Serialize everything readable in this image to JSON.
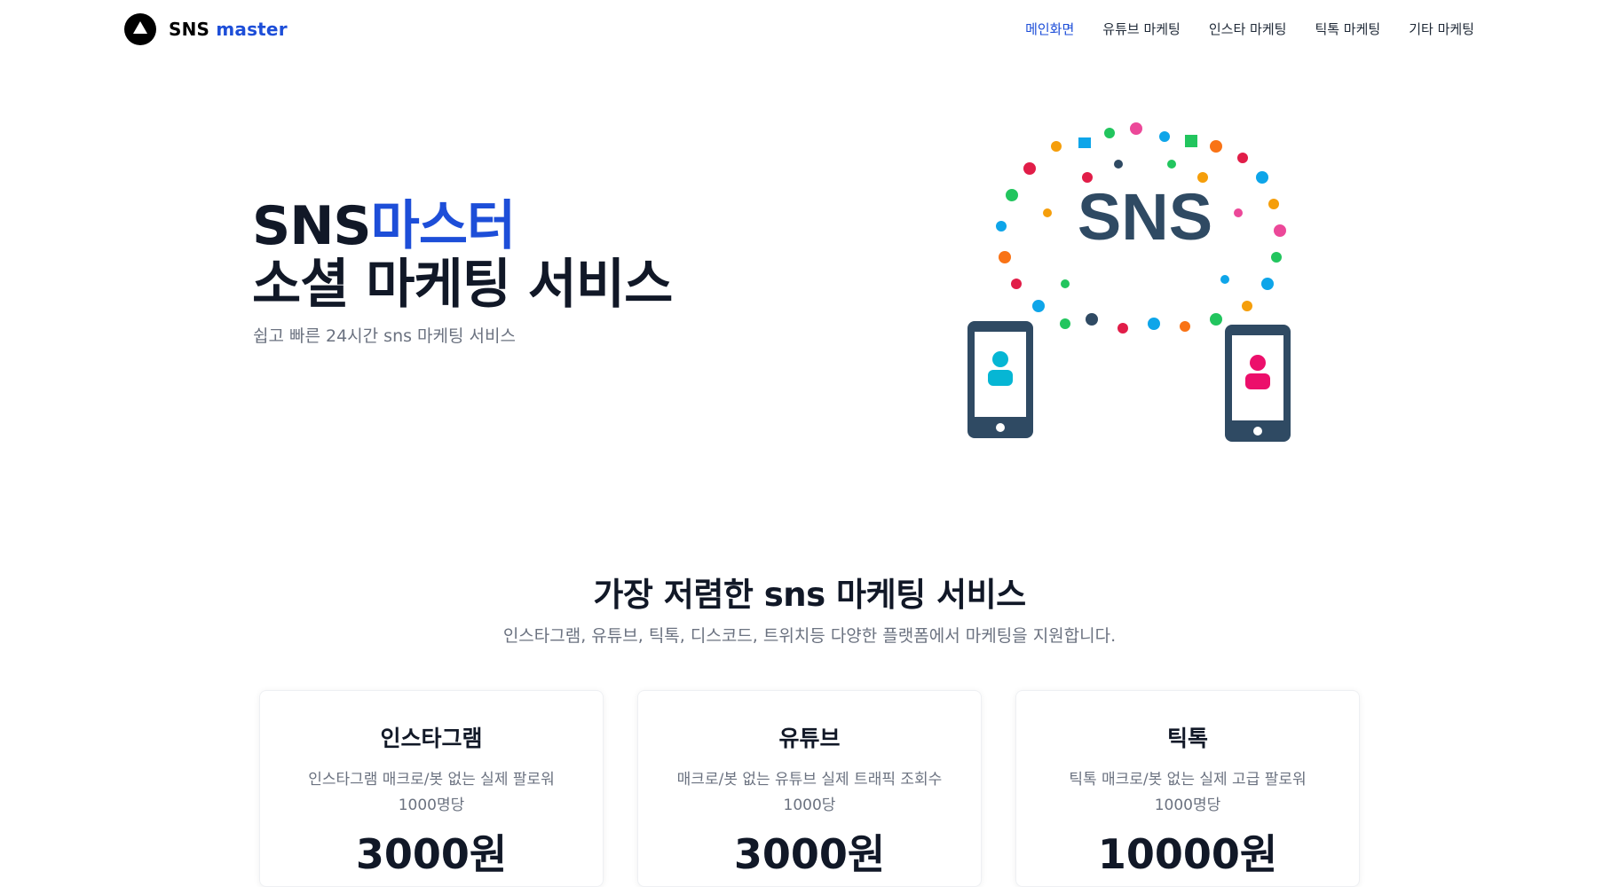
{
  "header": {
    "logo_primary": "SNS",
    "logo_accent": "master",
    "nav": [
      "메인화면",
      "유튜브 마케팅",
      "인스타 마케팅",
      "틱톡 마케팅",
      "기타 마케팅"
    ],
    "active_index": 0
  },
  "hero": {
    "title_line1_a": "SNS",
    "title_line1_b": "마스터",
    "title_line2": "소셜 마케팅 서비스",
    "subtitle": "쉽고 빠른 24시간 sns 마케팅 서비스",
    "illustration_text": "SNS"
  },
  "section": {
    "title": "가장 저렴한 sns 마케팅 서비스",
    "subtitle": "인스타그램, 유튜브, 틱톡, 디스코드, 트위치등 다양한 플랫폼에서 마케팅을 지원합니다."
  },
  "cards": [
    {
      "name": "인스타그램",
      "desc_line1": "인스타그램 매크로/봇 없는 실제 팔로워",
      "desc_line2": "1000명당",
      "price": "3000원"
    },
    {
      "name": "유튜브",
      "desc_line1": "매크로/봇 없는 유튜브 실제 트래픽 조회수",
      "desc_line2": "1000당",
      "price": "3000원"
    },
    {
      "name": "틱톡",
      "desc_line1": "틱톡 매크로/봇 없는 실제 고급 팔로워",
      "desc_line2": "1000명당",
      "price": "10000원"
    }
  ],
  "colors": {
    "accent": "#1d4ed8",
    "text": "#111827",
    "muted": "#6b7280",
    "phone": "#2f4a63"
  }
}
